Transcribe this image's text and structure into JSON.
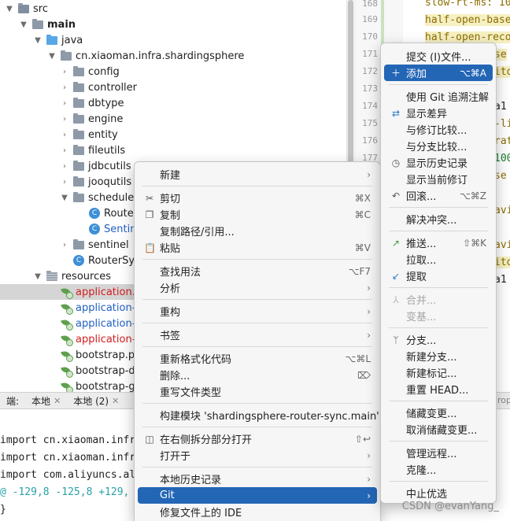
{
  "tree": {
    "items": [
      {
        "label": "src"
      },
      {
        "label": "main"
      },
      {
        "label": "java"
      },
      {
        "label": "cn.xiaoman.infra.shardingsphere"
      },
      {
        "label": "config"
      },
      {
        "label": "controller"
      },
      {
        "label": "dbtype"
      },
      {
        "label": "engine"
      },
      {
        "label": "entity"
      },
      {
        "label": "fileutils"
      },
      {
        "label": "jdbcutils"
      },
      {
        "label": "jooqutils"
      },
      {
        "label": "schedule"
      },
      {
        "label": "Router"
      },
      {
        "label": "Sentin"
      },
      {
        "label": "sentinel"
      },
      {
        "label": "RouterSyn"
      },
      {
        "label": "resources"
      },
      {
        "label": "application.y"
      },
      {
        "label": "application-"
      },
      {
        "label": "application-g"
      },
      {
        "label": "application-p"
      },
      {
        "label": "bootstrap.pr"
      },
      {
        "label": "bootstrap-de"
      },
      {
        "label": "bootstrap-gr"
      },
      {
        "label": "bootstrap-pr"
      }
    ]
  },
  "editor": {
    "line_numbers": [
      "168",
      "169",
      "170",
      "171",
      "172",
      "173",
      "174",
      "175",
      "176",
      "177",
      "178"
    ],
    "lines": [
      "slow-rt-ms: 10",
      "half-open-base",
      "half-open-reco",
      "se",
      "ito",
      "a1",
      "-li",
      "rat",
      "100",
      "se",
      "avi",
      "avi",
      "ito",
      "a1"
    ]
  },
  "bottom": {
    "tabs": [
      {
        "label": "端:"
      },
      {
        "label": "本地"
      },
      {
        "label": "本地 (2)"
      }
    ],
    "right_label": "rop",
    "lines": [
      "import cn.xiaoman.infr",
      "import cn.xiaoman.infr",
      "import com.aliyuncs.al",
      "@ -129,8 -125,8 +129,",
      "    }"
    ]
  },
  "context_menu": {
    "items": [
      {
        "label": "新建",
        "shortcut": ""
      },
      {
        "label": "剪切",
        "shortcut": "⌘X"
      },
      {
        "label": "复制",
        "shortcut": "⌘C"
      },
      {
        "label": "复制路径/引用...",
        "shortcut": ""
      },
      {
        "label": "粘贴",
        "shortcut": "⌘V"
      },
      {
        "label": "查找用法",
        "shortcut": "⌥F7"
      },
      {
        "label": "分析",
        "shortcut": ""
      },
      {
        "label": "重构",
        "shortcut": ""
      },
      {
        "label": "书签",
        "shortcut": ""
      },
      {
        "label": "重新格式化代码",
        "shortcut": "⌥⌘L"
      },
      {
        "label": "删除...",
        "shortcut": "⌦"
      },
      {
        "label": "重写文件类型",
        "shortcut": ""
      },
      {
        "label": "构建模块 'shardingsphere-router-sync.main'",
        "shortcut": ""
      },
      {
        "label": "在右侧拆分部分打开",
        "shortcut": "⇧↩"
      },
      {
        "label": "打开于",
        "shortcut": ""
      },
      {
        "label": "本地历史记录",
        "shortcut": ""
      },
      {
        "label": "Git",
        "shortcut": ""
      },
      {
        "label": "修复文件上的 IDE",
        "shortcut": ""
      }
    ]
  },
  "git_menu": {
    "items": [
      {
        "label": "提交 (I)文件...",
        "shortcut": ""
      },
      {
        "label": "添加",
        "shortcut": "⌥⌘A"
      },
      {
        "label": "使用 Git 追溯注解",
        "shortcut": ""
      },
      {
        "label": "显示差异",
        "shortcut": ""
      },
      {
        "label": "与修订比较...",
        "shortcut": ""
      },
      {
        "label": "与分支比较...",
        "shortcut": ""
      },
      {
        "label": "显示历史记录",
        "shortcut": ""
      },
      {
        "label": "显示当前修订",
        "shortcut": ""
      },
      {
        "label": "回滚...",
        "shortcut": "⌥⌘Z"
      },
      {
        "label": "解决冲突...",
        "shortcut": ""
      },
      {
        "label": "推送...",
        "shortcut": "⇧⌘K"
      },
      {
        "label": "拉取...",
        "shortcut": ""
      },
      {
        "label": "提取",
        "shortcut": ""
      },
      {
        "label": "合并...",
        "shortcut": ""
      },
      {
        "label": "变基...",
        "shortcut": ""
      },
      {
        "label": "分支...",
        "shortcut": ""
      },
      {
        "label": "新建分支...",
        "shortcut": ""
      },
      {
        "label": "新建标记...",
        "shortcut": ""
      },
      {
        "label": "重置 HEAD...",
        "shortcut": ""
      },
      {
        "label": "储藏变更...",
        "shortcut": ""
      },
      {
        "label": "取消储藏变更...",
        "shortcut": ""
      },
      {
        "label": "管理远程...",
        "shortcut": ""
      },
      {
        "label": "克隆...",
        "shortcut": ""
      },
      {
        "label": "中止优选",
        "shortcut": ""
      }
    ]
  },
  "watermark": "CSDN @evanYang_",
  "colors": {
    "accent": "#2466b6",
    "selection": "#d5d5d5",
    "error_text": "#d21d1d"
  },
  "icons": [
    "folder-icon",
    "java-folder-icon",
    "resources-folder-icon",
    "class-icon",
    "spring-config-icon",
    "scissors-icon",
    "copy-icon",
    "paste-icon",
    "split-icon",
    "plus-icon",
    "diff-icon",
    "history-icon",
    "revert-icon",
    "push-icon",
    "fetch-icon",
    "merge-icon",
    "branch-icon",
    "chevron-right-icon",
    "chevron-down-icon"
  ]
}
